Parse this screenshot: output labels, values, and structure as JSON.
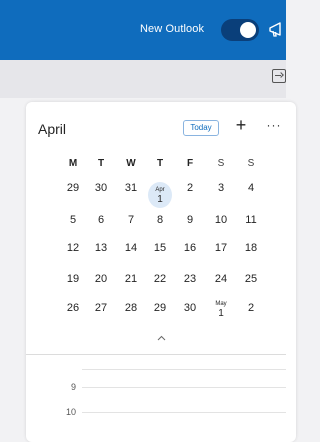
{
  "header": {
    "toggle_label": "New Outlook",
    "toggle_on": true,
    "accent_color": "#0f6cbd",
    "icons": [
      "megaphone-icon"
    ]
  },
  "toolbar": {
    "expand_icon": "expand-panel-icon"
  },
  "calendar": {
    "month": "April",
    "today_label": "Today",
    "plus_label": "+",
    "more_label": "···",
    "weekdays": [
      "M",
      "T",
      "W",
      "T",
      "F",
      "S",
      "S"
    ],
    "weeks": [
      [
        "29",
        "30",
        "31",
        "Apr|1",
        "2",
        "3",
        "4"
      ],
      [
        "5",
        "6",
        "7",
        "8",
        "9",
        "10",
        "11"
      ],
      [
        "12",
        "13",
        "14",
        "15",
        "16",
        "17",
        "18"
      ],
      [
        "19",
        "20",
        "21",
        "22",
        "23",
        "24",
        "25"
      ],
      [
        "26",
        "27",
        "28",
        "29",
        "30",
        "May|1",
        "2"
      ]
    ],
    "selected_day": "Apr 1",
    "selected_color": "#dce9f7",
    "collapse_icon": "chevron-up-icon"
  },
  "schedule": {
    "hours": [
      "9",
      "10"
    ]
  }
}
